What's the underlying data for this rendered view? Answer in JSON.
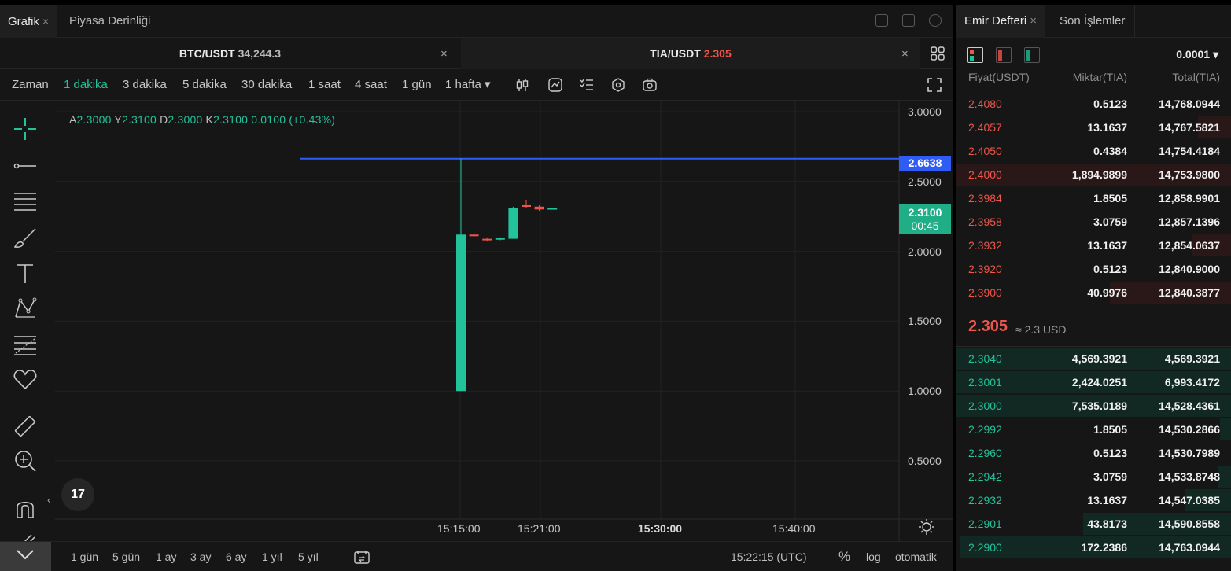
{
  "left_tabs": [
    {
      "label": "Grafik",
      "close": "×"
    },
    {
      "label": "Piyasa Derinliği"
    }
  ],
  "symbols": [
    {
      "pair": "BTC/USDT",
      "price": "34,244.3",
      "close": "×"
    },
    {
      "pair": "TIA/USDT",
      "price": "2.305",
      "close": "×"
    }
  ],
  "intervals": {
    "label": "Zaman",
    "items": [
      "1 dakika",
      "3 dakika",
      "5 dakika",
      "30 dakika",
      "1 saat",
      "4 saat",
      "1 gün",
      "1 hafta ▾"
    ],
    "selected": "1 dakika"
  },
  "legend": {
    "a_key": "A",
    "a_val": "2.3000",
    "y_key": "Y",
    "y_val": "2.3100",
    "d_key": "D",
    "d_val": "2.3000",
    "k_key": "K",
    "k_val": "2.3100",
    "change": "0.0100 (+0.43%)"
  },
  "price_boxes": {
    "line_price": "2.6638",
    "last_price": "2.3100",
    "countdown": "00:45"
  },
  "tv_logo": "17",
  "chart_data": {
    "type": "candlestick",
    "y_ticks": [
      "3.0000",
      "2.5000",
      "2.0000",
      "1.5000",
      "1.0000",
      "0.5000"
    ],
    "ylim": [
      0.5,
      3.0
    ],
    "x_ticks": [
      {
        "label": "15:15:00",
        "bold": false
      },
      {
        "label": "15:21:00",
        "bold": false
      },
      {
        "label": "15:30:00",
        "bold": true
      },
      {
        "label": "15:40:00",
        "bold": false
      }
    ],
    "horizontal_line": 2.6638,
    "last_price_line": 2.31,
    "candles": [
      {
        "time": "15:15",
        "open": 1.0,
        "high": 2.6638,
        "low": 1.0,
        "close": 2.12,
        "color": "#22c39a"
      },
      {
        "time": "15:16",
        "open": 2.12,
        "high": 2.13,
        "low": 2.1,
        "close": 2.11,
        "color": "#f0554a"
      },
      {
        "time": "15:17",
        "open": 2.09,
        "high": 2.1,
        "low": 2.07,
        "close": 2.08,
        "color": "#f0554a"
      },
      {
        "time": "15:18",
        "open": 2.09,
        "high": 2.1,
        "low": 2.08,
        "close": 2.095,
        "color": "#22c39a"
      },
      {
        "time": "15:19",
        "open": 2.09,
        "high": 2.32,
        "low": 2.09,
        "close": 2.31,
        "color": "#22c39a"
      },
      {
        "time": "15:20",
        "open": 2.33,
        "high": 2.37,
        "low": 2.31,
        "close": 2.32,
        "color": "#f0554a"
      },
      {
        "time": "15:21",
        "open": 2.32,
        "high": 2.33,
        "low": 2.29,
        "close": 2.3,
        "color": "#f0554a"
      },
      {
        "time": "15:22",
        "open": 2.3,
        "high": 2.31,
        "low": 2.3,
        "close": 2.31,
        "color": "#22c39a"
      }
    ]
  },
  "ranges": [
    "1 gün",
    "5 gün",
    "1 ay",
    "3 ay",
    "6 ay",
    "1 yıl",
    "5 yıl"
  ],
  "bottom_right": {
    "clock": "15:22:15 (UTC)",
    "percent": "%",
    "log": "log",
    "auto": "otomatik"
  },
  "right_tabs": [
    {
      "label": "Emir Defteri",
      "close": "×"
    },
    {
      "label": "Son İşlemler"
    }
  ],
  "orderbook": {
    "precision": "0.0001 ▾",
    "headers": [
      "Fiyat(USDT)",
      "Miktar(TIA)",
      "Total(TIA)"
    ],
    "asks": [
      {
        "price": "2.4080",
        "amount": "0.5123",
        "total": "14,768.0944",
        "depth": 0.0
      },
      {
        "price": "2.4057",
        "amount": "13.1637",
        "total": "14,767.5821",
        "depth": 0.12
      },
      {
        "price": "2.4050",
        "amount": "0.4384",
        "total": "14,754.4184",
        "depth": 0.0
      },
      {
        "price": "2.4000",
        "amount": "1,894.9899",
        "total": "14,753.9800",
        "depth": 1.0
      },
      {
        "price": "2.3984",
        "amount": "1.8505",
        "total": "12,858.9901",
        "depth": 0.0
      },
      {
        "price": "2.3958",
        "amount": "3.0759",
        "total": "12,857.1396",
        "depth": 0.0
      },
      {
        "price": "2.3932",
        "amount": "13.1637",
        "total": "12,854.0637",
        "depth": 0.14
      },
      {
        "price": "2.3920",
        "amount": "0.5123",
        "total": "12,840.9000",
        "depth": 0.0
      },
      {
        "price": "2.3900",
        "amount": "40.9976",
        "total": "12,840.3877",
        "depth": 0.44
      }
    ],
    "mid_price": "2.305",
    "mid_usd": "≈ 2.3 USD",
    "bids": [
      {
        "price": "2.3040",
        "amount": "4,569.3921",
        "total": "4,569.3921",
        "depth": 1.0
      },
      {
        "price": "2.3001",
        "amount": "2,424.0251",
        "total": "6,993.4172",
        "depth": 1.0
      },
      {
        "price": "2.3000",
        "amount": "7,535.0189",
        "total": "14,528.4361",
        "depth": 1.0
      },
      {
        "price": "2.2992",
        "amount": "1.8505",
        "total": "14,530.2866",
        "depth": 0.04
      },
      {
        "price": "2.2960",
        "amount": "0.5123",
        "total": "14,530.7989",
        "depth": 0.0
      },
      {
        "price": "2.2942",
        "amount": "3.0759",
        "total": "14,533.8748",
        "depth": 0.05
      },
      {
        "price": "2.2932",
        "amount": "13.1637",
        "total": "14,547.0385",
        "depth": 0.17
      },
      {
        "price": "2.2901",
        "amount": "43.8173",
        "total": "14,590.8558",
        "depth": 0.54
      },
      {
        "price": "2.2900",
        "amount": "172.2386",
        "total": "14,763.0944",
        "depth": 0.99
      }
    ]
  },
  "colors": {
    "up": "#22c39a",
    "down": "#f0554a",
    "line": "#2f5cf5",
    "bg": "#161616"
  }
}
